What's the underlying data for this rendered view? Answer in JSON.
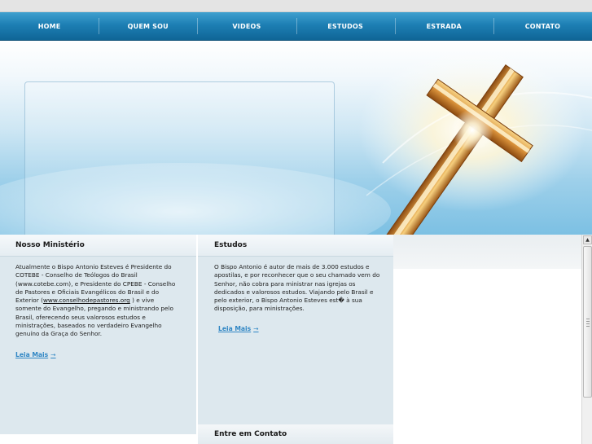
{
  "nav": {
    "items": [
      "HOME",
      "QUEM SOU",
      "VIDEOS",
      "ESTUDOS",
      "ESTRADA",
      "CONTATO"
    ]
  },
  "ministry": {
    "title": "Nosso Ministério",
    "text_before_link": "Atualmente o Bispo  Antonio Esteves é Presidente do COTEBE - Conselho de Teólogos do Brasil (www.cotebe.com), e Presidente do CPEBE - Conselho de Pastores e Oficiais Evangélicos do Brasil e do Exterior (",
    "link": "www.conselhodepastores.org",
    "text_after_link": " ) e vive somente do Evangelho, pregando e ministrando pelo Brasil, oferecendo seus valorosos estudos e ministrações, baseados no verdadeiro Evangelho genuíno da Graça do Senhor.",
    "more_label": "Leia Mais"
  },
  "studies": {
    "title": "Estudos",
    "text": "O Bispo Antonio é autor de mais de 3.000 estudos e apostilas, e por reconhecer que o seu chamado vem do Senhor, não cobra para ministrar nas igrejas os dedicados e valorosos estudos. Viajando pelo Brasil e pelo exterior, o Bispo Antonio Esteves est� à sua disposição, para ministrações.",
    "more_label": "Leia Mais"
  },
  "contact": {
    "title": "Entre em Contato"
  },
  "icons": {
    "more_arrow": "arrow-right-icon",
    "scroll_up": "arrow-up-icon"
  },
  "colors": {
    "nav": "#1d7fb4",
    "link": "#2f86c4",
    "panel": "#dde8ee"
  }
}
